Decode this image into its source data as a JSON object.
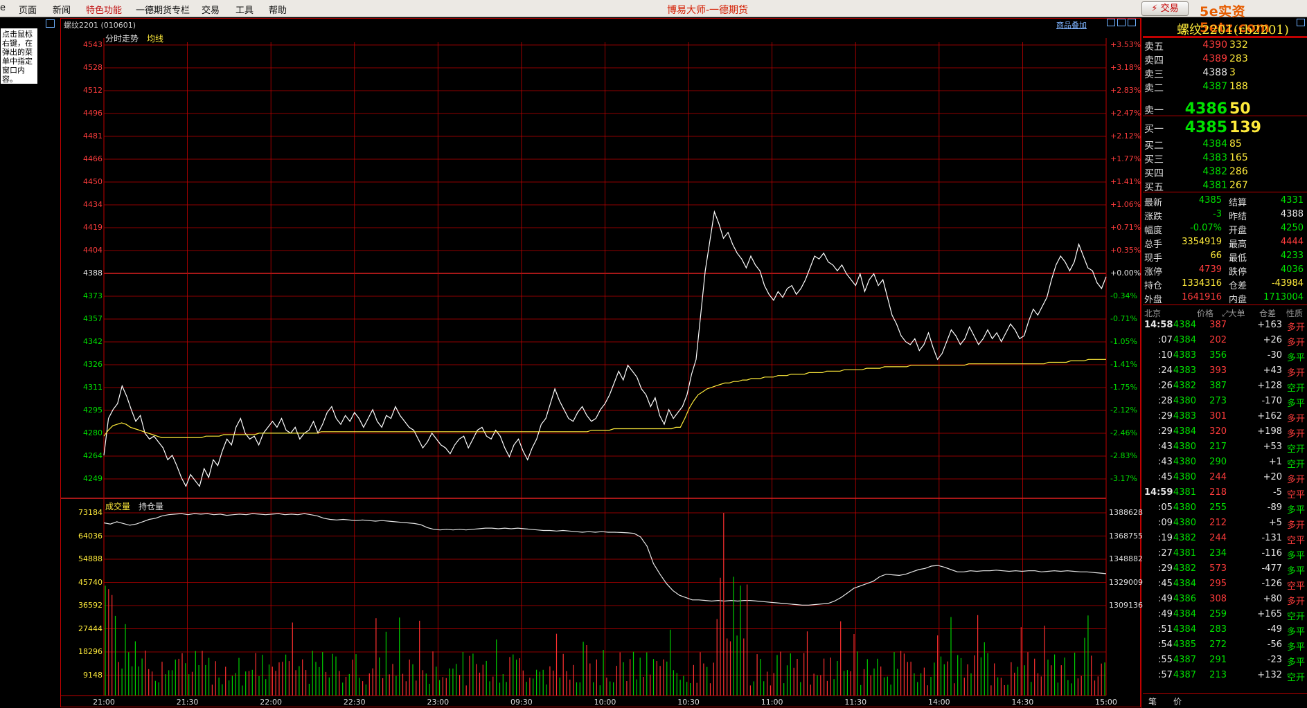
{
  "menu": {
    "items": [
      "页面",
      "新闻",
      "特色功能",
      "一德期货专栏",
      "交易",
      "工具",
      "帮助"
    ],
    "highlight_index": 2,
    "app_title": "博易大师-一德期货",
    "trade_button": "⚡ 交易",
    "site_watermark": "5e实资5etz.com"
  },
  "left_tip": "点击鼠标右键，在弹出的菜单中指定窗口内容。",
  "chart": {
    "header": "螺纹2201 (010601)",
    "overlay_link": "商品叠加",
    "tab_intraday": "分时走势",
    "tab_avg": "均线",
    "price_ticks": [
      "4543",
      "4528",
      "4512",
      "4496",
      "4481",
      "4466",
      "4450",
      "4434",
      "4419",
      "4404",
      "4388",
      "4373",
      "4357",
      "4342",
      "4326",
      "4311",
      "4295",
      "4280",
      "4264",
      "4249"
    ],
    "pct_ticks": [
      "+3.53%",
      "+3.18%",
      "+2.83%",
      "+2.47%",
      "+2.12%",
      "+1.77%",
      "+1.41%",
      "+1.06%",
      "+0.71%",
      "+0.35%",
      "+0.00%",
      "-0.34%",
      "-0.71%",
      "-1.05%",
      "-1.41%",
      "-1.75%",
      "-2.12%",
      "-2.46%",
      "-2.83%",
      "-3.17%"
    ],
    "vol_label": "成交量",
    "oi_label": "持仓量",
    "vol_ticks": [
      "73184",
      "64036",
      "54888",
      "45740",
      "36592",
      "27444",
      "18296",
      "9148"
    ],
    "oi_ticks": [
      "1388628",
      "1368755",
      "1348882",
      "1329009",
      "1309136"
    ],
    "time_ticks": [
      "21:00",
      "21:30",
      "22:00",
      "22:30",
      "23:00",
      "09:30",
      "10:00",
      "10:30",
      "11:00",
      "11:30",
      "14:00",
      "14:30",
      "15:00"
    ],
    "price_series": [
      4265,
      4290,
      4296,
      4300,
      4312,
      4305,
      4296,
      4288,
      4292,
      4280,
      4276,
      4278,
      4274,
      4270,
      4262,
      4265,
      4258,
      4250,
      4244,
      4252,
      4248,
      4244,
      4256,
      4250,
      4262,
      4258,
      4268,
      4276,
      4272,
      4284,
      4290,
      4280,
      4276,
      4278,
      4272,
      4280,
      4284,
      4288,
      4284,
      4290,
      4282,
      4280,
      4284,
      4276,
      4280,
      4282,
      4288,
      4280,
      4286,
      4294,
      4298,
      4290,
      4286,
      4292,
      4288,
      4294,
      4290,
      4284,
      4290,
      4296,
      4288,
      4284,
      4292,
      4290,
      4298,
      4292,
      4288,
      4284,
      4282,
      4276,
      4270,
      4274,
      4280,
      4276,
      4272,
      4270,
      4266,
      4272,
      4276,
      4278,
      4270,
      4276,
      4282,
      4284,
      4278,
      4276,
      4282,
      4278,
      4270,
      4264,
      4272,
      4276,
      4268,
      4262,
      4270,
      4276,
      4286,
      4290,
      4300,
      4310,
      4302,
      4296,
      4290,
      4288,
      4294,
      4298,
      4292,
      4288,
      4290,
      4296,
      4300,
      4306,
      4314,
      4322,
      4316,
      4326,
      4322,
      4318,
      4310,
      4306,
      4298,
      4304,
      4292,
      4286,
      4296,
      4290,
      4294,
      4298,
      4306,
      4320,
      4330,
      4360,
      4390,
      4410,
      4430,
      4422,
      4412,
      4416,
      4408,
      4402,
      4398,
      4392,
      4400,
      4394,
      4390,
      4380,
      4374,
      4370,
      4376,
      4372,
      4378,
      4380,
      4374,
      4378,
      4384,
      4392,
      4400,
      4398,
      4402,
      4396,
      4394,
      4390,
      4394,
      4388,
      4384,
      4380,
      4388,
      4376,
      4384,
      4388,
      4380,
      4384,
      4372,
      4360,
      4354,
      4346,
      4342,
      4340,
      4344,
      4336,
      4340,
      4348,
      4338,
      4330,
      4334,
      4342,
      4350,
      4346,
      4340,
      4344,
      4352,
      4346,
      4340,
      4344,
      4350,
      4344,
      4348,
      4342,
      4348,
      4354,
      4350,
      4344,
      4346,
      4356,
      4364,
      4360,
      4366,
      4372,
      4384,
      4394,
      4400,
      4396,
      4390,
      4396,
      4408,
      4400,
      4392,
      4390,
      4382,
      4378,
      4386
    ],
    "avg_series": [
      4278,
      4282,
      4285,
      4286,
      4287,
      4286,
      4284,
      4283,
      4282,
      4281,
      4280,
      4279,
      4278,
      4277,
      4277,
      4277,
      4277,
      4277,
      4277,
      4277,
      4277,
      4277,
      4277,
      4278,
      4278,
      4278,
      4278,
      4279,
      4279,
      4279,
      4279,
      4279,
      4279,
      4279,
      4279,
      4280,
      4280,
      4280,
      4280,
      4280,
      4280,
      4280,
      4280,
      4280,
      4280,
      4280,
      4280,
      4280,
      4280,
      4281,
      4281,
      4281,
      4281,
      4281,
      4281,
      4281,
      4281,
      4281,
      4281,
      4281,
      4281,
      4281,
      4281,
      4281,
      4281,
      4281,
      4281,
      4281,
      4281,
      4281,
      4281,
      4281,
      4281,
      4281,
      4281,
      4281,
      4281,
      4281,
      4281,
      4281,
      4281,
      4281,
      4281,
      4281,
      4281,
      4281,
      4281,
      4281,
      4281,
      4281,
      4281,
      4281,
      4281,
      4281,
      4281,
      4281,
      4281,
      4281,
      4281,
      4281,
      4281,
      4281,
      4281,
      4281,
      4281,
      4281,
      4281,
      4281,
      4281,
      4281,
      4282,
      4282,
      4282,
      4282,
      4282,
      4283,
      4283,
      4283,
      4283,
      4283,
      4283,
      4283,
      4283,
      4283,
      4283,
      4283,
      4283,
      4283,
      4283,
      4284,
      4284,
      4290,
      4297,
      4302,
      4306,
      4308,
      4310,
      4311,
      4312,
      4313,
      4314,
      4314,
      4315,
      4315,
      4316,
      4316,
      4317,
      4317,
      4317,
      4318,
      4318,
      4318,
      4319,
      4319,
      4319,
      4320,
      4320,
      4320,
      4320,
      4321,
      4321,
      4321,
      4321,
      4322,
      4322,
      4322,
      4322,
      4323,
      4323,
      4323,
      4323,
      4323,
      4324,
      4324,
      4324,
      4324,
      4325,
      4325,
      4325,
      4325,
      4325,
      4325,
      4326,
      4326,
      4326,
      4326,
      4326,
      4326,
      4326,
      4326,
      4326,
      4326,
      4326,
      4326,
      4326,
      4327,
      4327,
      4327,
      4327,
      4327,
      4327,
      4327,
      4327,
      4327,
      4327,
      4327,
      4327,
      4327,
      4327,
      4327,
      4327,
      4327,
      4327,
      4328,
      4328,
      4328,
      4328,
      4328,
      4329,
      4329,
      4329,
      4329,
      4330,
      4330,
      4330,
      4330,
      4330
    ],
    "oi_series": [
      1380000,
      1379000,
      1381000,
      1379500,
      1378000,
      1379000,
      1381000,
      1383000,
      1384000,
      1386000,
      1387000,
      1387500,
      1388000,
      1387000,
      1388000,
      1387500,
      1388000,
      1387000,
      1387500,
      1386500,
      1387000,
      1387500,
      1387000,
      1388000,
      1387500,
      1387000,
      1387500,
      1388000,
      1387000,
      1387500,
      1387000,
      1388000,
      1387000,
      1386000,
      1384000,
      1383000,
      1382500,
      1383000,
      1382500,
      1382000,
      1382500,
      1382000,
      1381500,
      1382000,
      1381500,
      1381000,
      1380500,
      1380000,
      1379500,
      1378500,
      1376000,
      1374500,
      1374000,
      1374500,
      1374000,
      1374500,
      1374000,
      1374500,
      1375000,
      1375500,
      1375500,
      1375000,
      1375500,
      1375000,
      1375500,
      1375000,
      1374500,
      1374000,
      1373500,
      1373500,
      1373000,
      1373500,
      1373000,
      1372500,
      1372000,
      1372500,
      1372000,
      1372500,
      1372000,
      1372000,
      1371800,
      1371500,
      1371000,
      1368000,
      1360000,
      1345000,
      1336000,
      1328000,
      1322000,
      1318000,
      1316000,
      1314000,
      1314000,
      1313500,
      1313000,
      1313500,
      1313000,
      1313500,
      1313000,
      1313500,
      1313500,
      1313000,
      1312500,
      1312000,
      1311500,
      1311000,
      1310500,
      1310000,
      1309500,
      1309500,
      1310000,
      1310500,
      1311000,
      1313000,
      1316000,
      1320000,
      1324000,
      1326000,
      1328000,
      1330000,
      1334000,
      1336000,
      1335500,
      1335000,
      1336000,
      1338000,
      1340000,
      1341000,
      1343000,
      1343500,
      1342000,
      1340000,
      1338000,
      1338000,
      1339000,
      1338500,
      1339000,
      1339000,
      1339500,
      1339000,
      1338500,
      1339000,
      1338500,
      1339000,
      1339000,
      1338000,
      1338500,
      1339000,
      1338500,
      1339000,
      1338500,
      1338000,
      1338000,
      1337500,
      1337000,
      1336500
    ]
  },
  "panel": {
    "contract_title": "螺纹2201(rb2201)",
    "asks": [
      {
        "label": "卖五",
        "price": "4390",
        "qty": "332"
      },
      {
        "label": "卖四",
        "price": "4389",
        "qty": "283"
      },
      {
        "label": "卖三",
        "price": "4388",
        "qty": "3"
      },
      {
        "label": "卖二",
        "price": "4387",
        "qty": "188"
      },
      {
        "label": "卖一",
        "price": "4386",
        "qty": "50"
      }
    ],
    "bids": [
      {
        "label": "买一",
        "price": "4385",
        "qty": "139"
      },
      {
        "label": "买二",
        "price": "4384",
        "qty": "85"
      },
      {
        "label": "买三",
        "price": "4383",
        "qty": "165"
      },
      {
        "label": "买四",
        "price": "4382",
        "qty": "286"
      },
      {
        "label": "买五",
        "price": "4381",
        "qty": "267"
      }
    ],
    "quotes": [
      {
        "l1": "最新",
        "v1": "4385",
        "c1": "green",
        "l2": "结算",
        "v2": "4331",
        "c2": "green"
      },
      {
        "l1": "涨跌",
        "v1": "-3",
        "c1": "green",
        "l2": "昨结",
        "v2": "4388",
        "c2": "white"
      },
      {
        "l1": "幅度",
        "v1": "-0.07%",
        "c1": "green",
        "l2": "开盘",
        "v2": "4250",
        "c2": "green"
      },
      {
        "l1": "总手",
        "v1": "3354919",
        "c1": "yellow",
        "l2": "最高",
        "v2": "4444",
        "c2": "red"
      },
      {
        "l1": "现手",
        "v1": "66",
        "c1": "yellow",
        "l2": "最低",
        "v2": "4233",
        "c2": "green"
      },
      {
        "l1": "涨停",
        "v1": "4739",
        "c1": "red",
        "l2": "跌停",
        "v2": "4036",
        "c2": "green"
      },
      {
        "l1": "持仓",
        "v1": "1334316",
        "c1": "yellow",
        "l2": "仓差",
        "v2": "-43984",
        "c2": "yellow"
      },
      {
        "l1": "外盘",
        "v1": "1641916",
        "c1": "red",
        "l2": "内盘",
        "v2": "1713004",
        "c2": "green"
      }
    ],
    "tick_headers": {
      "time": "北京",
      "price": "价格",
      "big": "⤢大单",
      "oi_diff": "仓差",
      "nature": "性质"
    },
    "ticks": [
      {
        "time": "14:58",
        "price": "4384",
        "vol": "387",
        "vc": "red",
        "diff": "+163",
        "nature": "多开",
        "nc": "red",
        "bold": true
      },
      {
        "time": ":07",
        "price": "4384",
        "vol": "202",
        "vc": "red",
        "diff": "+26",
        "nature": "多开",
        "nc": "red"
      },
      {
        "time": ":10",
        "price": "4383",
        "vol": "356",
        "vc": "green",
        "diff": "-30",
        "nature": "多平",
        "nc": "green"
      },
      {
        "time": ":24",
        "price": "4383",
        "vol": "393",
        "vc": "red",
        "diff": "+43",
        "nature": "多开",
        "nc": "red"
      },
      {
        "time": ":26",
        "price": "4382",
        "vol": "387",
        "vc": "green",
        "diff": "+128",
        "nature": "空开",
        "nc": "green"
      },
      {
        "time": ":28",
        "price": "4380",
        "vol": "273",
        "vc": "green",
        "diff": "-170",
        "nature": "多平",
        "nc": "green"
      },
      {
        "time": ":29",
        "price": "4383",
        "vol": "301",
        "vc": "red",
        "diff": "+162",
        "nature": "多开",
        "nc": "red"
      },
      {
        "time": ":29",
        "price": "4384",
        "vol": "320",
        "vc": "red",
        "diff": "+198",
        "nature": "多开",
        "nc": "red"
      },
      {
        "time": ":43",
        "price": "4380",
        "vol": "217",
        "vc": "green",
        "diff": "+53",
        "nature": "空开",
        "nc": "green"
      },
      {
        "time": ":43",
        "price": "4380",
        "vol": "290",
        "vc": "green",
        "diff": "+1",
        "nature": "空开",
        "nc": "green"
      },
      {
        "time": ":45",
        "price": "4380",
        "vol": "244",
        "vc": "red",
        "diff": "+20",
        "nature": "多开",
        "nc": "red"
      },
      {
        "time": "14:59",
        "price": "4381",
        "vol": "218",
        "vc": "red",
        "diff": "-5",
        "nature": "空平",
        "nc": "red",
        "bold": true
      },
      {
        "time": ":05",
        "price": "4380",
        "vol": "255",
        "vc": "green",
        "diff": "-89",
        "nature": "多平",
        "nc": "green"
      },
      {
        "time": ":09",
        "price": "4380",
        "vol": "212",
        "vc": "red",
        "diff": "+5",
        "nature": "多开",
        "nc": "red"
      },
      {
        "time": ":19",
        "price": "4382",
        "vol": "244",
        "vc": "red",
        "diff": "-131",
        "nature": "空平",
        "nc": "red"
      },
      {
        "time": ":27",
        "price": "4381",
        "vol": "234",
        "vc": "green",
        "diff": "-116",
        "nature": "多平",
        "nc": "green"
      },
      {
        "time": ":29",
        "price": "4382",
        "vol": "573",
        "vc": "red",
        "diff": "-477",
        "nature": "多平",
        "nc": "green"
      },
      {
        "time": ":45",
        "price": "4384",
        "vol": "295",
        "vc": "red",
        "diff": "-126",
        "nature": "空平",
        "nc": "red"
      },
      {
        "time": ":49",
        "price": "4386",
        "vol": "308",
        "vc": "red",
        "diff": "+80",
        "nature": "多开",
        "nc": "red"
      },
      {
        "time": ":49",
        "price": "4384",
        "vol": "259",
        "vc": "green",
        "diff": "+165",
        "nature": "空开",
        "nc": "green"
      },
      {
        "time": ":51",
        "price": "4384",
        "vol": "283",
        "vc": "green",
        "diff": "-49",
        "nature": "多平",
        "nc": "green"
      },
      {
        "time": ":54",
        "price": "4385",
        "vol": "272",
        "vc": "green",
        "diff": "-56",
        "nature": "多平",
        "nc": "green"
      },
      {
        "time": ":55",
        "price": "4387",
        "vol": "291",
        "vc": "green",
        "diff": "-23",
        "nature": "多平",
        "nc": "green"
      },
      {
        "time": ":57",
        "price": "4387",
        "vol": "213",
        "vc": "green",
        "diff": "+132",
        "nature": "空开",
        "nc": "green"
      }
    ],
    "tabs": [
      "笔",
      "价"
    ]
  },
  "colors": {
    "frame": "#c00000",
    "up": "#ff3c3c",
    "down": "#00e000",
    "avg": "#ffeb3b",
    "price_line": "#ffffff"
  }
}
